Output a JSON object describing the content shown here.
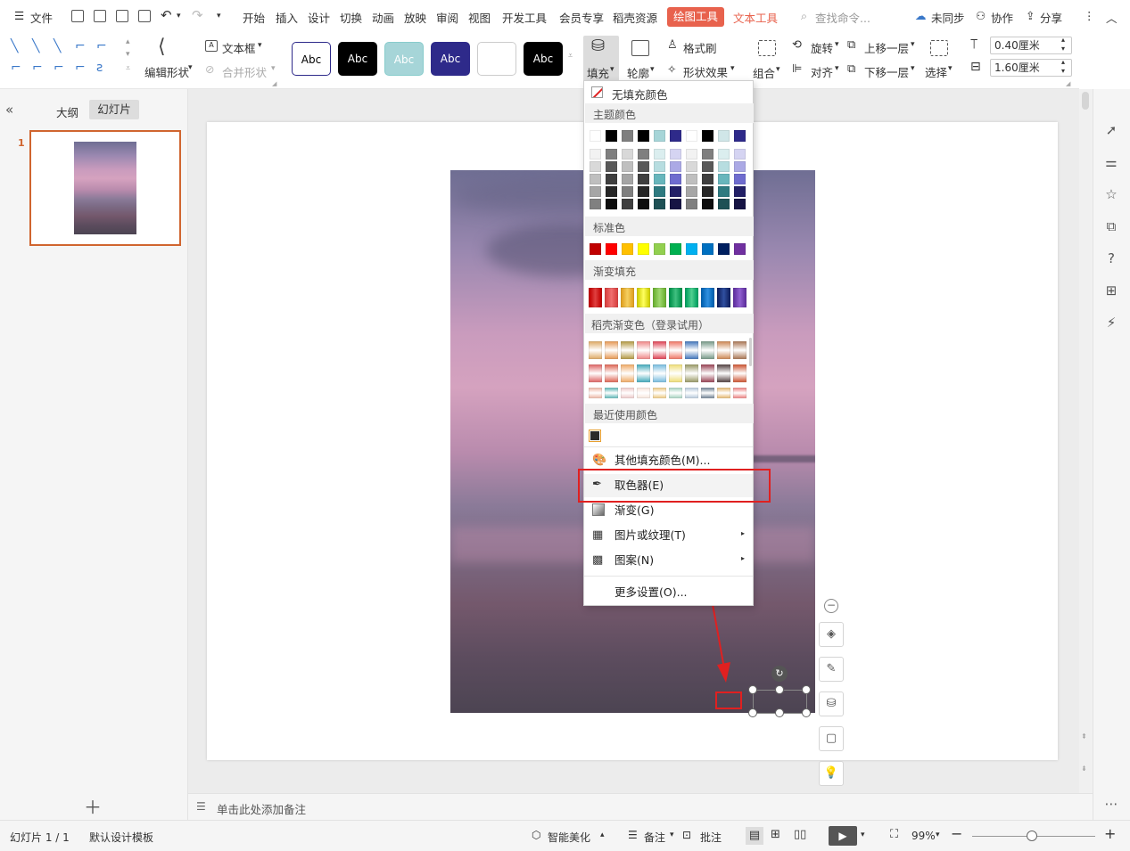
{
  "menubar": {
    "file_label": "文件",
    "tabs": [
      "开始",
      "插入",
      "设计",
      "切换",
      "动画",
      "放映",
      "审阅",
      "视图",
      "开发工具",
      "会员专享",
      "稻壳资源"
    ],
    "draw_tools_tab": "绘图工具",
    "text_tools_tab": "文本工具",
    "search_placeholder": "查找命令...",
    "sync_label": "未同步",
    "collab_label": "协作",
    "share_label": "分享"
  },
  "ribbon": {
    "edit_shape_label": "编辑形状",
    "textbox_label": "文本框",
    "merge_shape_label": "合并形状",
    "style_presets": [
      "Abc",
      "Abc",
      "Abc",
      "Abc",
      "",
      "Abc"
    ],
    "fill_label": "填充",
    "outline_label": "轮廓",
    "format_painter_label": "格式刷",
    "shape_effects_label": "形状效果",
    "group_label": "组合",
    "rotate_label": "旋转",
    "align_label": "对齐",
    "bring_forward_label": "上移一层",
    "send_backward_label": "下移一层",
    "select_label": "选择",
    "height_value": "0.40厘米",
    "width_value": "1.60厘米"
  },
  "left_panel": {
    "tab_outline": "大纲",
    "tab_slides": "幻灯片",
    "slide_number": "1"
  },
  "notes_placeholder": "单击此处添加备注",
  "status": {
    "slide_info": "幻灯片 1 / 1",
    "template": "默认设计模板",
    "smart_beautify": "智能美化",
    "notes": "备注",
    "comments": "批注",
    "zoom": "99%"
  },
  "fill_menu": {
    "no_fill": "无填充颜色",
    "theme_colors": "主题颜色",
    "standard_colors": "标准色",
    "gradient_fill": "渐变填充",
    "docer_gradient": "稻壳渐变色（登录试用）",
    "recent_colors": "最近使用颜色",
    "more_fill_colors": "其他填充颜色(M)...",
    "eyedropper": "取色器(E)",
    "gradient": "渐变(G)",
    "picture_texture": "图片或纹理(T)",
    "pattern": "图案(N)",
    "more_settings": "更多设置(O)..."
  },
  "colors": {
    "accent": "#e8624d",
    "highlight_box": "#e02020",
    "theme_row": [
      "#ffffff",
      "#000000",
      "#7f7f7f",
      "#000000",
      "#a6d5d8",
      "#2e2a8a",
      "#ffffff",
      "#000000",
      "#d0e6e8",
      "#2e2a8a"
    ],
    "standard": [
      "#c00000",
      "#ff0000",
      "#ffc000",
      "#ffff00",
      "#92d050",
      "#00b050",
      "#00b0f0",
      "#0070c0",
      "#002060",
      "#7030a0"
    ],
    "recent": [
      "#2b2b2b"
    ]
  }
}
